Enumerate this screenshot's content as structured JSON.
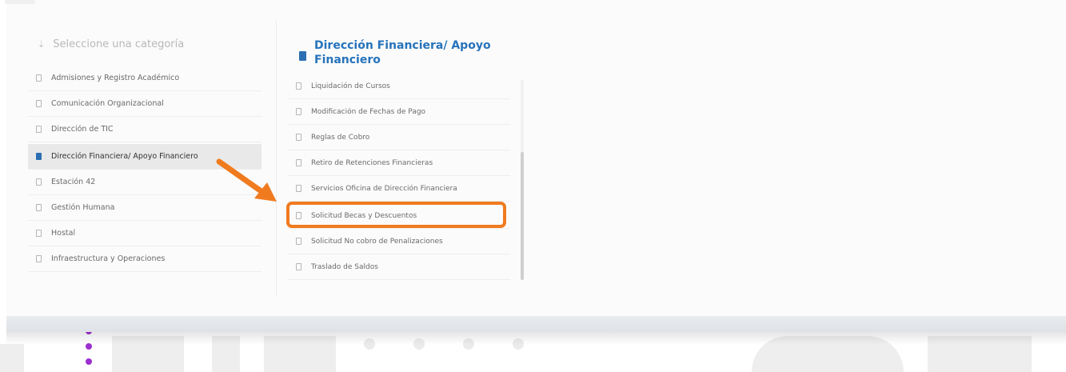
{
  "left": {
    "title": "Seleccione una categoría",
    "items": [
      {
        "label": "Admisiones y Registro Académico",
        "active": false
      },
      {
        "label": "Comunicación Organizacional",
        "active": false
      },
      {
        "label": "Dirección de TIC",
        "active": false
      },
      {
        "label": "Dirección Financiera/ Apoyo Financiero",
        "active": true
      },
      {
        "label": "Estación 42",
        "active": false
      },
      {
        "label": "Gestión Humana",
        "active": false
      },
      {
        "label": "Hostal",
        "active": false
      },
      {
        "label": "Infraestructura y Operaciones",
        "active": false
      }
    ]
  },
  "right": {
    "title": "Dirección Financiera/ Apoyo Financiero",
    "items": [
      {
        "label": "Liquidación de Cursos"
      },
      {
        "label": "Modificación de Fechas de Pago"
      },
      {
        "label": "Reglas de Cobro"
      },
      {
        "label": "Retiro de Retenciones Financieras"
      },
      {
        "label": "Servicios Oficina de Dirección Financiera"
      },
      {
        "label": "Solicitud Becas y Descuentos",
        "highlighted": true
      },
      {
        "label": "Solicitud No cobro de Penalizaciones"
      },
      {
        "label": "Traslado de Saldos"
      }
    ]
  },
  "colors": {
    "accent": "#2673bb",
    "highlight": "#f07b1f",
    "active_row": "#e9e9e9"
  }
}
